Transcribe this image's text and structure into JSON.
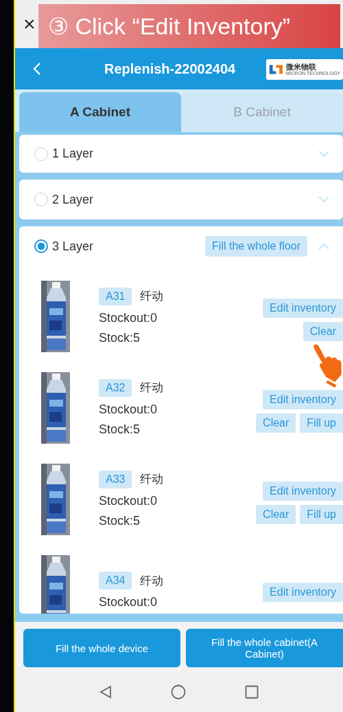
{
  "top_bar": {
    "close": "×",
    "banner": "③ Click “Edit Inventory”"
  },
  "header": {
    "title": "Replenish-22002404",
    "logo": {
      "name": "微米物联",
      "tagline": "MICRON TECHNOLOGY"
    }
  },
  "tabs": [
    {
      "label": "A Cabinet",
      "selected": true
    },
    {
      "label": "B Cabinet",
      "selected": false
    }
  ],
  "layers": [
    {
      "label": "1 Layer",
      "selected": false,
      "expanded": false
    },
    {
      "label": "2 Layer",
      "selected": false,
      "expanded": false
    },
    {
      "label": "3 Layer",
      "selected": true,
      "expanded": true,
      "action": "Fill the whole floor",
      "items": [
        {
          "slot": "A31",
          "name": "纤动",
          "stockout": "Stockout:0",
          "stock": "Stock:5",
          "buttons": [
            {
              "label": "Edit inventory",
              "kind": "edit"
            },
            {
              "label": "Clear",
              "kind": "clear"
            }
          ]
        },
        {
          "slot": "A32",
          "name": "纤动",
          "stockout": "Stockout:0",
          "stock": "Stock:5",
          "buttons": [
            {
              "label": "Edit inventory",
              "kind": "edit"
            },
            {
              "label": "Clear",
              "kind": "clear"
            },
            {
              "label": "Fill up",
              "kind": "fill"
            }
          ]
        },
        {
          "slot": "A33",
          "name": "纤动",
          "stockout": "Stockout:0",
          "stock": "Stock:5",
          "buttons": [
            {
              "label": "Edit inventory",
              "kind": "edit"
            },
            {
              "label": "Clear",
              "kind": "clear"
            },
            {
              "label": "Fill up",
              "kind": "fill"
            }
          ]
        },
        {
          "slot": "A34",
          "name": "纤动",
          "stockout": "Stockout:0",
          "buttons": [
            {
              "label": "Edit inventory",
              "kind": "edit"
            }
          ]
        }
      ]
    }
  ],
  "footer_buttons": [
    "Fill the whole device",
    "Fill the whole cabinet(A Cabinet)"
  ]
}
